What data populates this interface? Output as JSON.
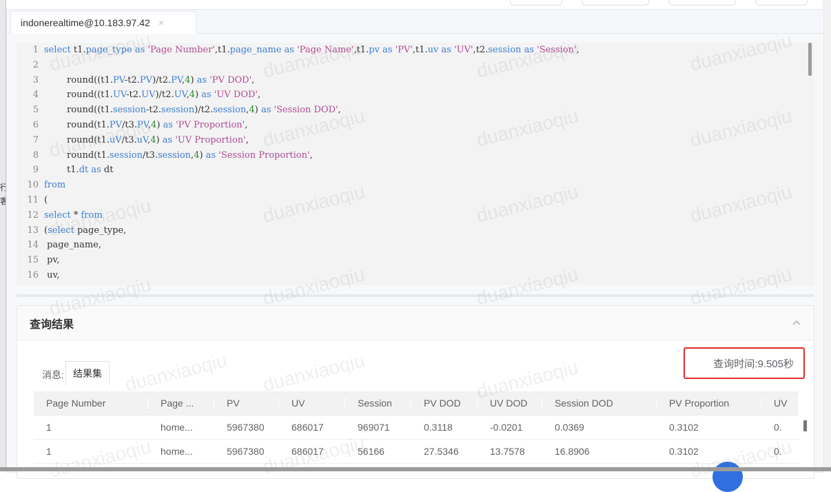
{
  "tab": {
    "title": "indonerealtime@10.183.97.42",
    "close_icon": "×"
  },
  "editor": {
    "lines": [
      {
        "n": "1",
        "parts": [
          {
            "t": "select",
            "c": "kw"
          },
          {
            "t": " t1.",
            "c": ""
          },
          {
            "t": "page_type",
            "c": "col"
          },
          {
            "t": " ",
            "c": ""
          },
          {
            "t": "as",
            "c": "kw"
          },
          {
            "t": " ",
            "c": ""
          },
          {
            "t": "'Page Number'",
            "c": "str"
          },
          {
            "t": ",t1.",
            "c": ""
          },
          {
            "t": "page_name",
            "c": "col"
          },
          {
            "t": " ",
            "c": ""
          },
          {
            "t": "as",
            "c": "kw"
          },
          {
            "t": " ",
            "c": ""
          },
          {
            "t": "'Page Name'",
            "c": "str"
          },
          {
            "t": ",t1.",
            "c": ""
          },
          {
            "t": "pv",
            "c": "col"
          },
          {
            "t": " ",
            "c": ""
          },
          {
            "t": "as",
            "c": "kw"
          },
          {
            "t": " ",
            "c": ""
          },
          {
            "t": "'PV'",
            "c": "str"
          },
          {
            "t": ",t1.",
            "c": ""
          },
          {
            "t": "uv",
            "c": "col"
          },
          {
            "t": " ",
            "c": ""
          },
          {
            "t": "as",
            "c": "kw"
          },
          {
            "t": " ",
            "c": ""
          },
          {
            "t": "'UV'",
            "c": "str"
          },
          {
            "t": ",t2.",
            "c": ""
          },
          {
            "t": "session",
            "c": "col"
          },
          {
            "t": " ",
            "c": ""
          },
          {
            "t": "as",
            "c": "kw"
          },
          {
            "t": " ",
            "c": ""
          },
          {
            "t": "'Session'",
            "c": "str"
          },
          {
            "t": ",",
            "c": ""
          }
        ]
      },
      {
        "n": "2",
        "parts": []
      },
      {
        "n": "3",
        "parts": [
          {
            "t": "        round((t1.",
            "c": ""
          },
          {
            "t": "PV",
            "c": "col"
          },
          {
            "t": "-t2.",
            "c": ""
          },
          {
            "t": "PV",
            "c": "col"
          },
          {
            "t": ")/t2.",
            "c": ""
          },
          {
            "t": "PV",
            "c": "col"
          },
          {
            "t": ",",
            "c": ""
          },
          {
            "t": "4",
            "c": "num"
          },
          {
            "t": ") ",
            "c": ""
          },
          {
            "t": "as",
            "c": "kw"
          },
          {
            "t": " ",
            "c": ""
          },
          {
            "t": "'PV DOD'",
            "c": "str"
          },
          {
            "t": ",",
            "c": ""
          }
        ]
      },
      {
        "n": "4",
        "parts": [
          {
            "t": "        round((t1.",
            "c": ""
          },
          {
            "t": "UV",
            "c": "col"
          },
          {
            "t": "-t2.",
            "c": ""
          },
          {
            "t": "UV",
            "c": "col"
          },
          {
            "t": ")/t2.",
            "c": ""
          },
          {
            "t": "UV",
            "c": "col"
          },
          {
            "t": ",",
            "c": ""
          },
          {
            "t": "4",
            "c": "num"
          },
          {
            "t": ") ",
            "c": ""
          },
          {
            "t": "as",
            "c": "kw"
          },
          {
            "t": " ",
            "c": ""
          },
          {
            "t": "'UV DOD'",
            "c": "str"
          },
          {
            "t": ",",
            "c": ""
          }
        ]
      },
      {
        "n": "5",
        "parts": [
          {
            "t": "        round((t1.",
            "c": ""
          },
          {
            "t": "session",
            "c": "col"
          },
          {
            "t": "-t2.",
            "c": ""
          },
          {
            "t": "session",
            "c": "col"
          },
          {
            "t": ")/t2.",
            "c": ""
          },
          {
            "t": "session",
            "c": "col"
          },
          {
            "t": ",",
            "c": ""
          },
          {
            "t": "4",
            "c": "num"
          },
          {
            "t": ") ",
            "c": ""
          },
          {
            "t": "as",
            "c": "kw"
          },
          {
            "t": " ",
            "c": ""
          },
          {
            "t": "'Session DOD'",
            "c": "str"
          },
          {
            "t": ",",
            "c": ""
          }
        ]
      },
      {
        "n": "6",
        "parts": [
          {
            "t": "        round(t1.",
            "c": ""
          },
          {
            "t": "PV",
            "c": "col"
          },
          {
            "t": "/t3.",
            "c": ""
          },
          {
            "t": "PV",
            "c": "col"
          },
          {
            "t": ",",
            "c": ""
          },
          {
            "t": "4",
            "c": "num"
          },
          {
            "t": ") ",
            "c": ""
          },
          {
            "t": "as",
            "c": "kw"
          },
          {
            "t": " ",
            "c": ""
          },
          {
            "t": "'PV Proportion'",
            "c": "str"
          },
          {
            "t": ",",
            "c": ""
          }
        ]
      },
      {
        "n": "7",
        "parts": [
          {
            "t": "        round(t1.",
            "c": ""
          },
          {
            "t": "uV",
            "c": "col"
          },
          {
            "t": "/t3.",
            "c": ""
          },
          {
            "t": "uV",
            "c": "col"
          },
          {
            "t": ",",
            "c": ""
          },
          {
            "t": "4",
            "c": "num"
          },
          {
            "t": ") ",
            "c": ""
          },
          {
            "t": "as",
            "c": "kw"
          },
          {
            "t": " ",
            "c": ""
          },
          {
            "t": "'UV Proportion'",
            "c": "str"
          },
          {
            "t": ",",
            "c": ""
          }
        ]
      },
      {
        "n": "8",
        "parts": [
          {
            "t": "        round(t1.",
            "c": ""
          },
          {
            "t": "session",
            "c": "col"
          },
          {
            "t": "/t3.",
            "c": ""
          },
          {
            "t": "session",
            "c": "col"
          },
          {
            "t": ",",
            "c": ""
          },
          {
            "t": "4",
            "c": "num"
          },
          {
            "t": ") ",
            "c": ""
          },
          {
            "t": "as",
            "c": "kw"
          },
          {
            "t": " ",
            "c": ""
          },
          {
            "t": "'Session Proportion'",
            "c": "str"
          },
          {
            "t": ",",
            "c": ""
          }
        ]
      },
      {
        "n": "9",
        "parts": [
          {
            "t": "        t1.",
            "c": ""
          },
          {
            "t": "dt",
            "c": "col"
          },
          {
            "t": " ",
            "c": ""
          },
          {
            "t": "as",
            "c": "kw"
          },
          {
            "t": " dt",
            "c": ""
          }
        ]
      },
      {
        "n": "10",
        "parts": [
          {
            "t": "from",
            "c": "kw"
          }
        ]
      },
      {
        "n": "11",
        "parts": [
          {
            "t": "(",
            "c": ""
          }
        ]
      },
      {
        "n": "12",
        "parts": [
          {
            "t": "select",
            "c": "kw"
          },
          {
            "t": " * ",
            "c": ""
          },
          {
            "t": "from",
            "c": "kw"
          }
        ]
      },
      {
        "n": "13",
        "parts": [
          {
            "t": "(",
            "c": ""
          },
          {
            "t": "select",
            "c": "kw"
          },
          {
            "t": " page_type,",
            "c": ""
          }
        ]
      },
      {
        "n": "14",
        "parts": [
          {
            "t": " page_name,",
            "c": ""
          }
        ]
      },
      {
        "n": "15",
        "parts": [
          {
            "t": " pv,",
            "c": ""
          }
        ]
      },
      {
        "n": "16",
        "parts": [
          {
            "t": " uv,",
            "c": ""
          }
        ]
      }
    ]
  },
  "result": {
    "title": "查询结果",
    "collapse_icon": "^",
    "msg_label": "消息:",
    "resultset_tab": "结果集",
    "query_time": "查询时间:9.505秒",
    "columns": [
      "Page Number",
      "Page ...",
      "PV",
      "UV",
      "Session",
      "PV DOD",
      "UV DOD",
      "Session DOD",
      "PV Proportion",
      "UV"
    ],
    "rows": [
      [
        "1",
        "home...",
        "5967380",
        "686017",
        "969071",
        "0.3118",
        "-0.0201",
        "0.0369",
        "0.3102",
        "0."
      ],
      [
        "1",
        "home...",
        "5967380",
        "686017",
        "56166",
        "27.5346",
        "13.7578",
        "16.8906",
        "0.3102",
        "0."
      ]
    ]
  },
  "watermark": "duanxiaoqiu",
  "left_artifacts": [
    "行",
    "客"
  ]
}
